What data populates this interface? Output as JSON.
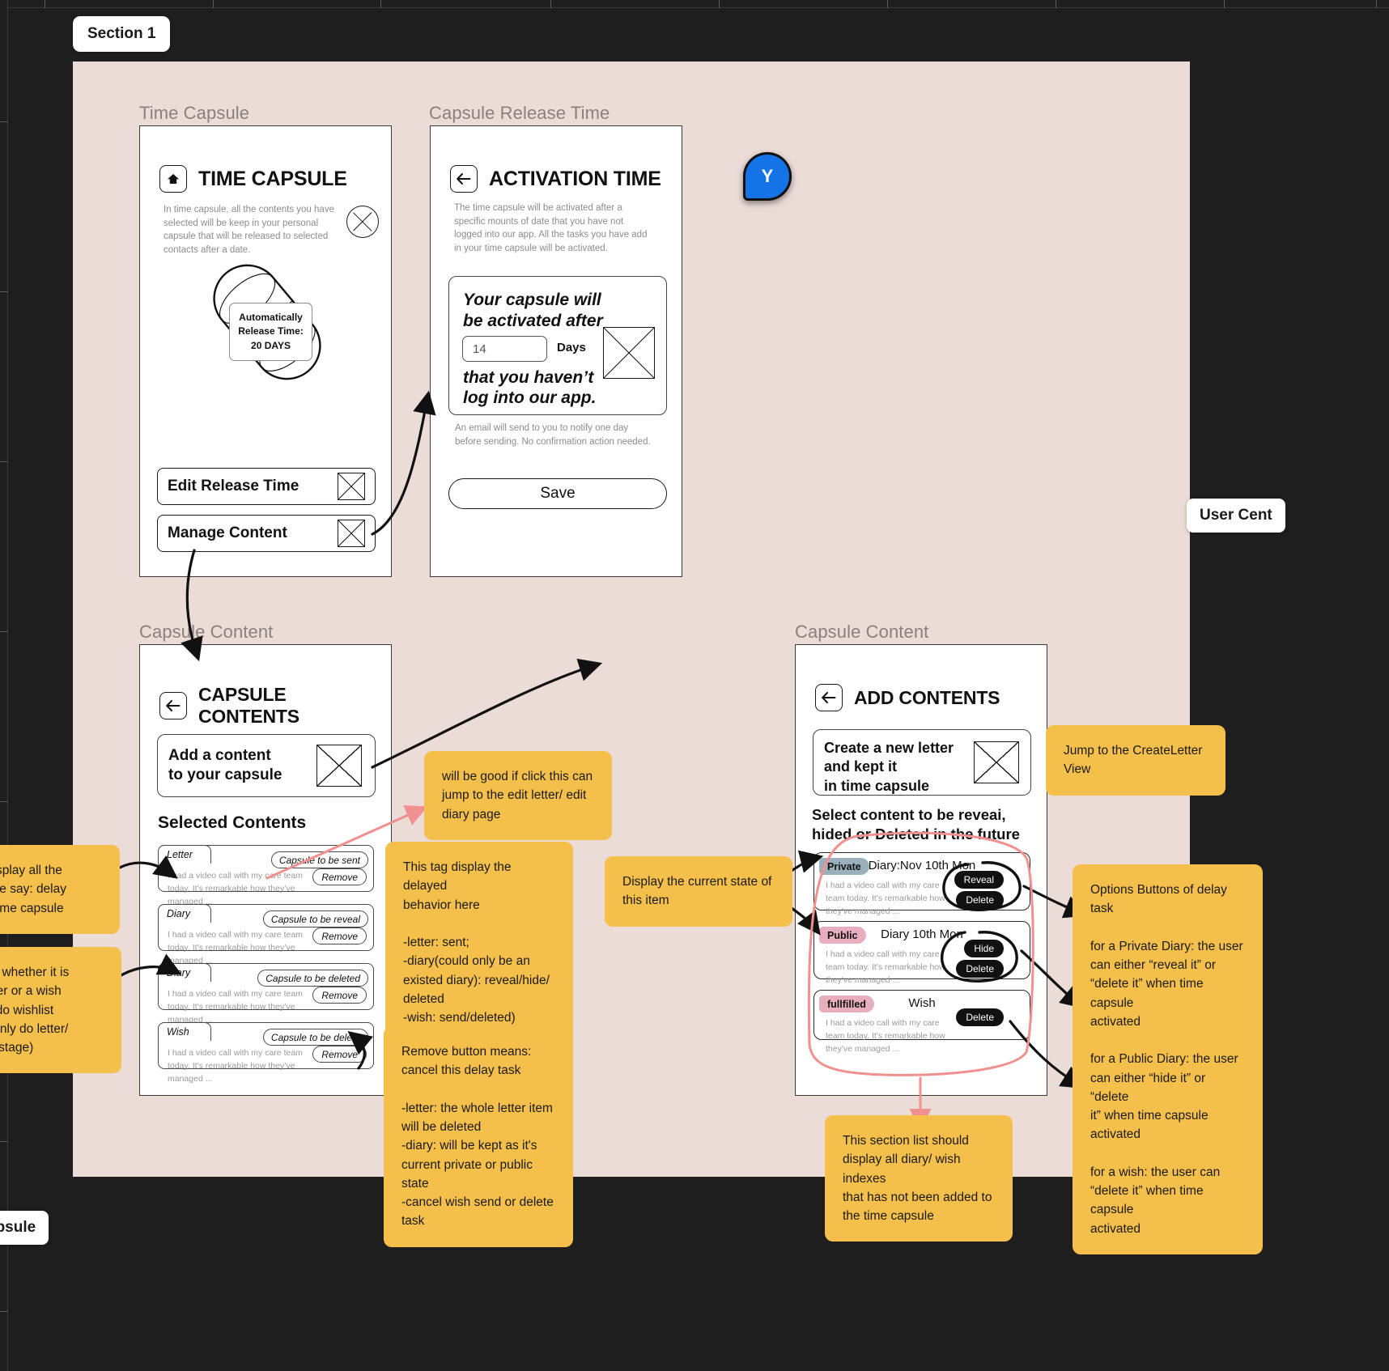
{
  "canvas": {
    "frame_label": "Section 1",
    "user_center_chip": "User Cent",
    "capsule_chip": "apsule",
    "cursor_initial": "Y",
    "cursor_color": "#1473e6",
    "frame_bg": "#ecdcd8",
    "note_color": "#f5bf4b"
  },
  "sections": {
    "time_capsule": "Time Capsule",
    "capsule_release_time": "Capsule Release Time",
    "capsule_content_left": "Capsule Content",
    "capsule_content_right": "Capsule Content"
  },
  "time_capsule_screen": {
    "home_icon": "home-icon",
    "title": "TIME CAPSULE",
    "description": "In time capsule, all the contents you have selected will be keep in your personal capsule that will be released to selected contacts after a date.",
    "close_icon": "circle-x-icon",
    "capsule_note_line1": "Automatically",
    "capsule_note_line2": "Release Time:",
    "capsule_note_line3": "20 DAYS",
    "buttons": [
      {
        "label": "Edit Release Time",
        "icon": "x-box-icon"
      },
      {
        "label": "Manage Content",
        "icon": "x-box-icon"
      }
    ]
  },
  "activation_screen": {
    "back_icon": "arrow-left-icon",
    "title": "ACTIVATION TIME",
    "description": "The time capsule will be activated after a specific mounts of date that you have not logged into our app. All the tasks you have add in your time capsule will be activated.",
    "card_line1": "Your capsule will",
    "card_line2": "be activated after",
    "days_value": "14",
    "days_label": "Days",
    "card_icon": "x-box-icon",
    "card_line3": "that you haven’t",
    "card_line4": "log into our app.",
    "footnote": "An email will send to you to notify one day before sending. No confirmation action needed.",
    "save_label": "Save"
  },
  "capsule_contents_screen": {
    "back_icon": "arrow-left-icon",
    "title": "CAPSULE CONTENTS",
    "add_card_line1": "Add a content",
    "add_card_line2": "to your capsule",
    "add_card_icon": "x-box-icon",
    "list_heading": "Selected Contents",
    "items": [
      {
        "type": "Letter",
        "tag": "Capsule to be sent",
        "body": "I had a video call with my care team today. It's remarkable how they’ve managed ...",
        "action": "Remove"
      },
      {
        "type": "Diary",
        "tag": "Capsule to be reveal",
        "body": "I had a video call with my care team today. It's remarkable how they’ve managed ...",
        "action": "Remove"
      },
      {
        "type": "Diary",
        "tag": "Capsule to be deleted",
        "body": "I had a video call with my care team today. It's remarkable how they’ve managed ...",
        "action": "Remove"
      },
      {
        "type": "Wish",
        "tag": "Capsule to be delete",
        "body": "I had a video call with my care team today. It's remarkable how they’ve managed ...",
        "action": "Remove"
      }
    ]
  },
  "add_contents_screen": {
    "back_icon": "arrow-left-icon",
    "title": "ADD CONTENTS",
    "create_card_line1": "Create a new letter",
    "create_card_line2": "and kept it",
    "create_card_line3": "in time capsule",
    "create_card_icon": "x-box-icon",
    "select_heading_line1": "Select content to be reveai,",
    "select_heading_line2": "hided or Deleted in the future",
    "items": [
      {
        "badge": "Private",
        "badge_color": "#9bb0bd",
        "title": "Diary:Nov 10th Mon",
        "body": "I had a video call with my care team today. It's remarkable how they've managed ...",
        "actions": [
          "Reveal",
          "Delete"
        ]
      },
      {
        "badge": "Public",
        "badge_color": "#e8aebd",
        "title": "Diary 10th Mon",
        "body": "I had a video call with my care team today. It's remarkable how they've managed ...",
        "actions": [
          "Hide",
          "Delete"
        ]
      },
      {
        "badge": "fullfilled",
        "badge_color": "#e8aebd",
        "title": "Wish",
        "body": "I had a video call with my care team today. It's remarkable how they've managed ...",
        "actions": [
          "Delete"
        ]
      }
    ]
  },
  "notes": {
    "left_display_all": "e display all the\nor we say: delay\nne time capsule",
    "left_display_whether": "splay whether it is\na letter or a wish\nf we do wishlist\ncan only do letter/\nrrent stage)",
    "click_edit": "will be good if click this can\njump to the edit letter/ edit\ndiary page",
    "tag_behavior": "This tag display the delayed\nbehavior here\n\n-letter: sent;\n-diary(could only be an\nexisted diary): reveal/hide/\ndeleted\n-wish: send/deleted)",
    "remove_meaning": "Remove button means:\ncancel this delay task\n\n-letter: the whole letter item\nwill be deleted\n-diary: will be kept as it's\ncurrent private or public state\n-cancel wish send or delete\ntask",
    "current_state": "Display the current state of\nthis item",
    "jump_create_letter": "Jump to the CreateLetter\nView",
    "options_buttons": "Options Buttons of delay task\n\nfor a Private Diary: the user\ncan either “reveal it” or\n“delete it” when time capsule\nactivated\n\nfor a Public Diary: the user\ncan either “hide it” or “delete\nit” when time capsule\nactivated\n\nfor a wish: the user can\n“delete it” when time capsule\nactivated",
    "section_list": "This section list should\ndisplay all diary/ wish indexes\nthat has not been added to\nthe time capsule"
  }
}
